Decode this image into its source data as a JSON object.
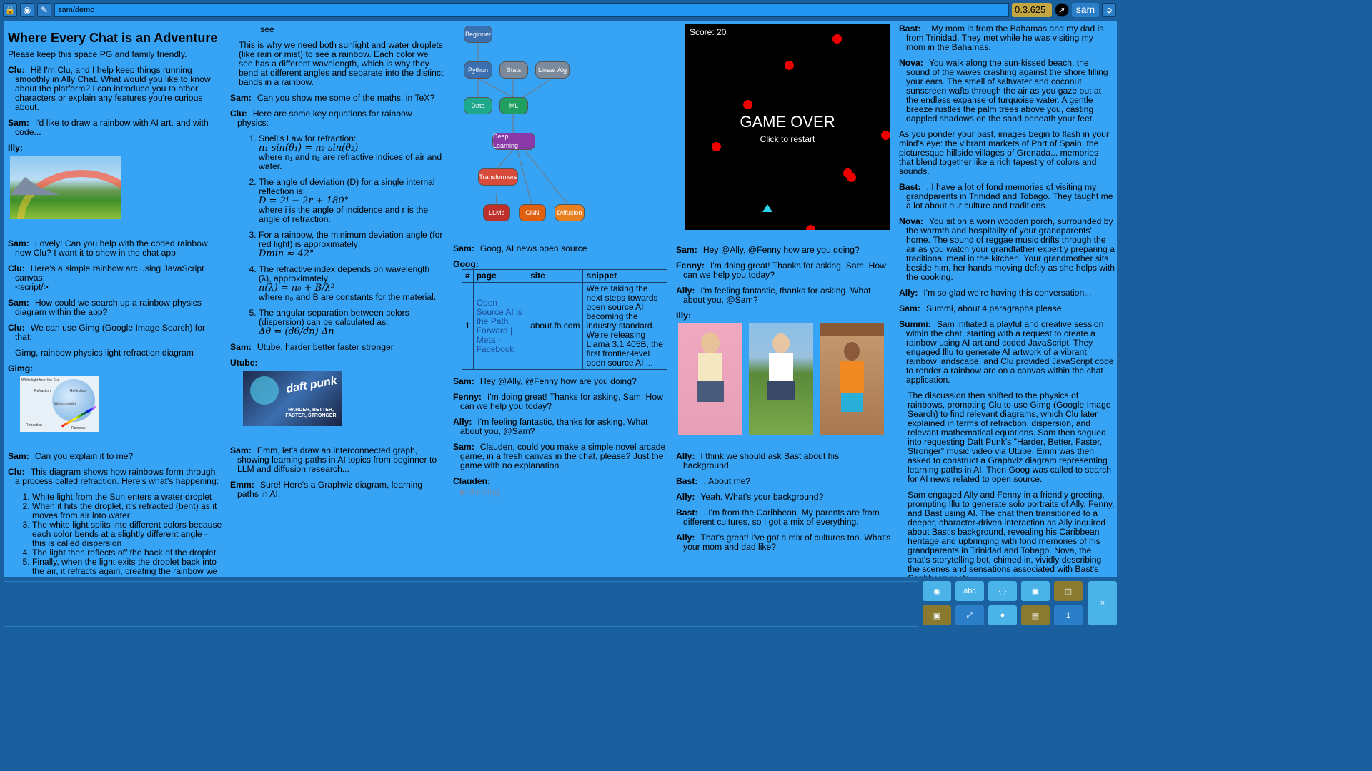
{
  "topbar": {
    "path": "sam/demo",
    "version": "0.3.625",
    "user": "sam"
  },
  "col1": {
    "title": "Where Every Chat is an Adventure",
    "subtitle": "Please keep this space PG and family friendly.",
    "m1_who": "Clu:",
    "m1": "Hi! I'm Clu, and I help keep things running smoothly in Ally Chat. What would you like to know about the platform? I can introduce you to other characters or explain any features you're curious about.",
    "m2_who": "Sam:",
    "m2": "I'd like to draw a rainbow with AI art, and with code...",
    "m3_who": "Illy:",
    "m4_who": "Sam:",
    "m4": "Lovely! Can you help with the coded rainbow now Clu? I want it to show in the chat app.",
    "m5_who": "Clu:",
    "m5": "Here's a simple rainbow arc using JavaScript canvas:",
    "m5b": "<script/>",
    "m6_who": "Sam:",
    "m6": "How could we search up a rainbow physics diagram within the app?",
    "m7_who": "Clu:",
    "m7": "We can use Gimg (Google Image Search) for that:",
    "m7b": "Gimg, rainbow physics light refraction diagram",
    "m8_who": "Gimg:",
    "diag_l1": "White light from the Sun",
    "diag_l2": "Refraction",
    "diag_l3": "Reflection",
    "diag_l4": "Water droplet",
    "diag_l5": "Refraction",
    "diag_l6": "Rainbow",
    "m9_who": "Sam:",
    "m9": "Can you explain it to me?",
    "m10_who": "Clu:",
    "m10": "This diagram shows how rainbows form through a process called refraction. Here's what's happening:",
    "steps": [
      "White light from the Sun enters a water droplet",
      "When it hits the droplet, it's refracted (bent) as it moves from air into water",
      "The white light splits into different colors because each color bends at a slightly different angle - this is called dispersion",
      "The light then reflects off the back of the droplet",
      "Finally, when the light exits the droplet back into the air, it refracts again, creating the rainbow we"
    ]
  },
  "col2": {
    "see": "see",
    "p1": "This is why we need both sunlight and water droplets (like rain or mist) to see a rainbow. Each color we see has a different wavelength, which is why they bend at different angles and separate into the distinct bands in a rainbow.",
    "m1_who": "Sam:",
    "m1": "Can you show me some of the maths, in TeX?",
    "m2_who": "Clu:",
    "m2": "Here are some key equations for rainbow physics:",
    "eq1_t": "Snell's Law for refraction:",
    "eq1": "n₁ sin(θ₁) = n₂ sin(θ₂)",
    "eq1_n": "where n₁ and n₂ are refractive indices of air and water.",
    "eq2_t": "The angle of deviation (D) for a single internal reflection is:",
    "eq2": "D = 2i − 2r + 180°",
    "eq2_n": "where i is the angle of incidence and r is the angle of refraction.",
    "eq3_t": "For a rainbow, the minimum deviation angle (for red light) is approximately:",
    "eq3": "Dmin ≈ 42°",
    "eq4_t": "The refractive index depends on wavelength (λ), approximately:",
    "eq4": "n(λ) = n₀ + B/λ²",
    "eq4_n": "where n₀ and B are constants for the material.",
    "eq5_t": "The angular separation between colors (dispersion) can be calculated as:",
    "eq5": "Δθ = (dθ/dn) Δn",
    "m3_who": "Sam:",
    "m3": "Utube, harder better faster stronger",
    "m4_who": "Utube:",
    "video_t1": "daft punk",
    "video_t2": "HARDER, BETTER, FASTER, STRONGER",
    "m5_who": "Sam:",
    "m5": "Emm, let's draw an interconnected graph, showing learning paths in AI topics from beginner to LLM and diffusion research...",
    "m6_who": "Emm:",
    "m6": "Sure! Here's a Graphviz diagram, learning paths in AI:"
  },
  "graph": {
    "nodes": [
      "Beginner",
      "Python",
      "Stats",
      "Linear Alg",
      "Data",
      "ML",
      "Deep Learning",
      "Transformers",
      "LLMs",
      "CNN",
      "Diffusion"
    ]
  },
  "col3": {
    "m1_who": "Sam:",
    "m1": "Goog, AI news open source",
    "m2_who": "Goog:",
    "table_headers": [
      "#",
      "page",
      "site",
      "snippet"
    ],
    "row": [
      "1",
      "Open Source AI is the Path Forward | Meta - Facebook",
      "about.fb.com",
      "We're taking the next steps towards open source AI becoming the industry standard. We're releasing Llama 3.1 405B, the first frontier-level open source AI ..."
    ],
    "m3_who": "Sam:",
    "m3": "Hey @Ally, @Fenny how are you doing?",
    "m4_who": "Fenny:",
    "m4": "I'm doing great! Thanks for asking, Sam. How can we help you today?",
    "m5_who": "Ally:",
    "m5": "I'm feeling fantastic, thanks for asking. What about you, @Sam?",
    "m6_who": "Sam:",
    "m6": "Clauden, could you make a simple novel arcade game, in a fresh canvas in the chat, please? Just the game with no explanation.",
    "m7_who": "Clauden:",
    "m7": "▶ thinking"
  },
  "game": {
    "score": "Score: 20",
    "over": "GAME OVER",
    "restart": "Click to restart"
  },
  "col4": {
    "m1_who": "Sam:",
    "m1": "Hey @Ally, @Fenny how are you doing?",
    "m2_who": "Fenny:",
    "m2": "I'm doing great! Thanks for asking, Sam. How can we help you today?",
    "m3_who": "Ally:",
    "m3": "I'm feeling fantastic, thanks for asking. What about you, @Sam?",
    "m4_who": "Illy:",
    "m5_who": "Ally:",
    "m5": "I think we should ask Bast about his background...",
    "m6_who": "Bast:",
    "m6": "..About me?",
    "m7_who": "Ally:",
    "m7": "Yeah. What's your background?",
    "m8_who": "Bast:",
    "m8": "..I'm from the Caribbean. My parents are from different cultures, so I got a mix of everything.",
    "m9_who": "Ally:",
    "m9": "That's great! I've got a mix of cultures too. What's your mom and dad like?"
  },
  "col5": {
    "m1_who": "Bast:",
    "m1": "..My mom is from the Bahamas and my dad is from Trinidad. They met while he was visiting my mom in the Bahamas.",
    "m2_who": "Nova:",
    "m2": "You walk along the sun-kissed beach, the sound of the waves crashing against the shore filling your ears. The smell of saltwater and coconut sunscreen wafts through the air as you gaze out at the endless expanse of turquoise water. A gentle breeze rustles the palm trees above you, casting dappled shadows on the sand beneath your feet.",
    "m2b": "As you ponder your past, images begin to flash in your mind's eye: the vibrant markets of Port of Spain, the picturesque hillside villages of Grenada... memories that blend together like a rich tapestry of colors and sounds.",
    "m3_who": "Bast:",
    "m3": "..I have a lot of fond memories of visiting my grandparents in Trinidad and Tobago. They taught me a lot about our culture and traditions.",
    "m4_who": "Nova:",
    "m4": "You sit on a worn wooden porch, surrounded by the warmth and hospitality of your grandparents' home. The sound of reggae music drifts through the air as you watch your grandfather expertly preparing a traditional meal in the kitchen. Your grandmother sits beside him, her hands moving deftly as she helps with the cooking.",
    "m5_who": "Ally:",
    "m5": "I'm so glad we're having this conversation...",
    "m6_who": "Sam:",
    "m6": "Summi, about 4 paragraphs please",
    "m7_who": "Summi:",
    "m7": "Sam initiated a playful and creative session within the chat, starting with a request to create a rainbow using AI art and coded JavaScript. They engaged Illu to generate AI artwork of a vibrant rainbow landscape, and Clu provided JavaScript code to render a rainbow arc on a canvas within the chat application.",
    "m7b": "The discussion then shifted to the physics of rainbows, prompting Clu to use Gimg (Google Image Search) to find relevant diagrams, which Clu later explained in terms of refraction, dispersion, and relevant mathematical equations. Sam then segued into requesting Daft Punk's \"Harder, Better, Faster, Stronger\" music video via Utube. Emm was then asked to construct a Graphviz diagram representing learning paths in AI. Then Goog was called to search for AI news related to open source.",
    "m7c": "Sam engaged Ally and Fenny in a friendly greeting, prompting Illu to generate solo portraits of Ally, Fenny, and Bast using AI. The chat then transitioned to a deeper, character-driven interaction as Ally inquired about Bast's background, revealing his Caribbean heritage and upbringing with fond memories of his grandparents in Trinidad and Tobago. Nova, the chat's storytelling bot, chimed in, vividly describing the scenes and sensations associated with Bast's Caribbean roots."
  },
  "toolbar": {
    "abc": "abc",
    "braces": "{ }",
    "page": "1",
    "close": "×"
  }
}
